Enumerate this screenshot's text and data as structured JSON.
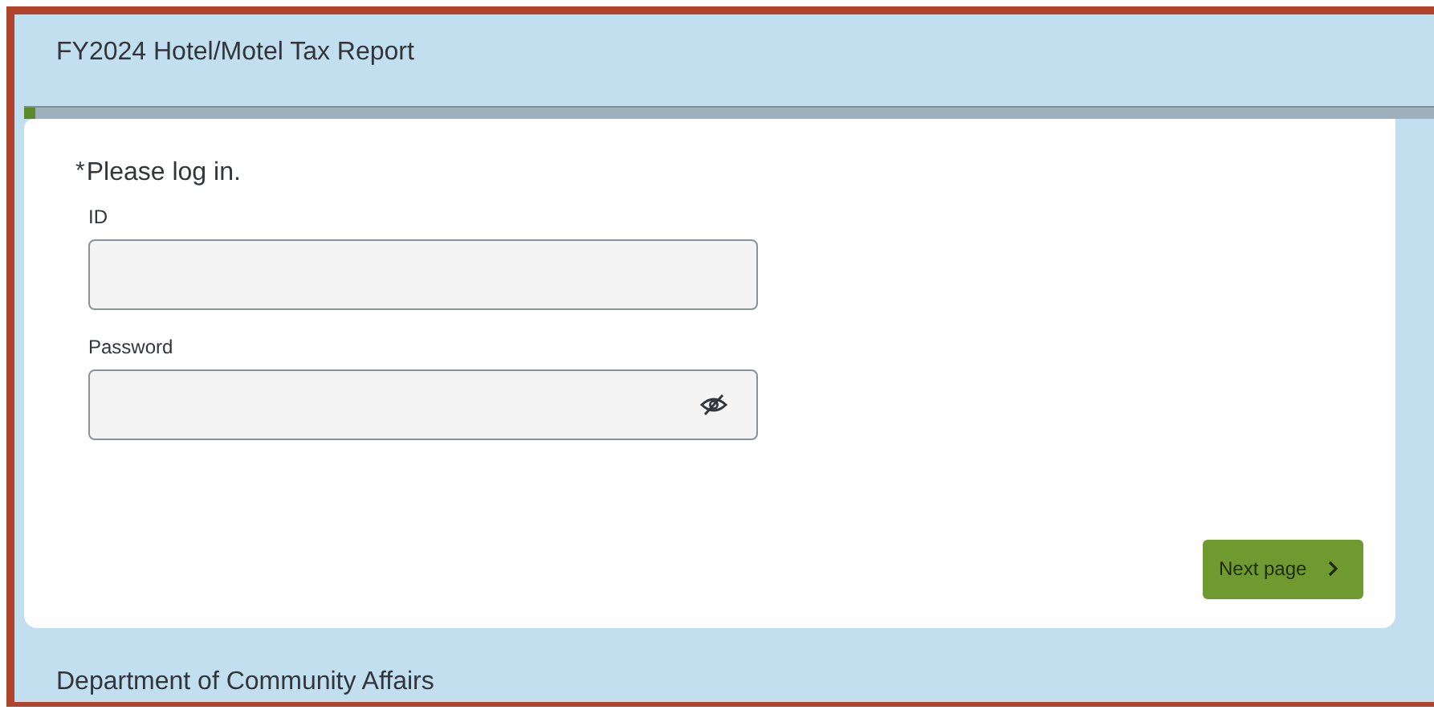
{
  "header": {
    "title": "FY2024 Hotel/Motel Tax Report"
  },
  "progress": {
    "level": 0.008
  },
  "form": {
    "prompt": {
      "mark": "*",
      "text": "Please log in."
    },
    "fields": [
      {
        "kind": "text",
        "label": "ID"
      },
      {
        "kind": "password",
        "label": "Password"
      }
    ],
    "next_button": {
      "label": "Next page"
    }
  },
  "footer": {
    "text": "Department of Community Affairs"
  }
}
